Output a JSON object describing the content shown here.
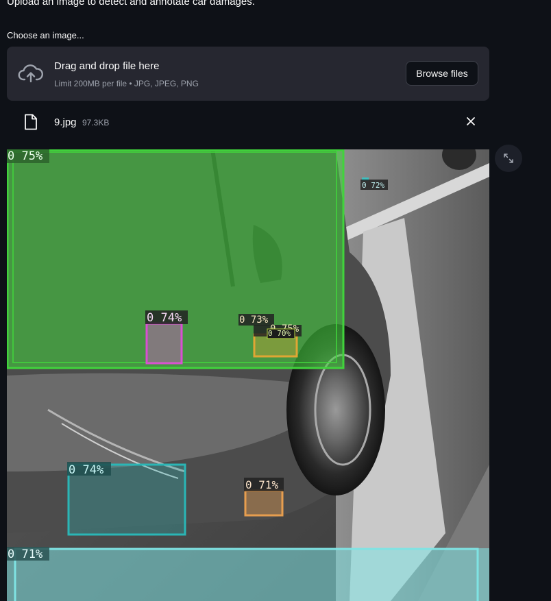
{
  "intro": "Upload an image to detect and annotate car damages.",
  "uploader": {
    "label": "Choose an image...",
    "drag_text": "Drag and drop file here",
    "limit_text": "Limit 200MB per file • JPG, JPEG, PNG",
    "browse_label": "Browse files",
    "icon": "cloud-upload-icon"
  },
  "file": {
    "name": "9.jpg",
    "size": "97.3KB",
    "icon": "file-icon",
    "remove_icon": "close-icon"
  },
  "image": {
    "fullscreen_icon": "expand-icon",
    "detections": [
      {
        "label": "0 75%",
        "color": "#41d33c"
      },
      {
        "label": "0 72%",
        "color": "#3fbfbf"
      },
      {
        "label": "0 74%",
        "color": "#d94fd2"
      },
      {
        "label": "0 73%",
        "color": "#e0a634"
      },
      {
        "label": "0 75%",
        "color": "#d6c13e"
      },
      {
        "label": "0 70%",
        "color": "#b4d441"
      },
      {
        "label": "0 74%",
        "color": "#2ab6b6"
      },
      {
        "label": "0 71%",
        "color": "#e79e4f"
      },
      {
        "label": "0 71%",
        "color": "#7fe3e3"
      }
    ]
  },
  "colors": {
    "background": "#0e1117",
    "panel": "#262730",
    "muted_text": "#9ea3ad"
  }
}
